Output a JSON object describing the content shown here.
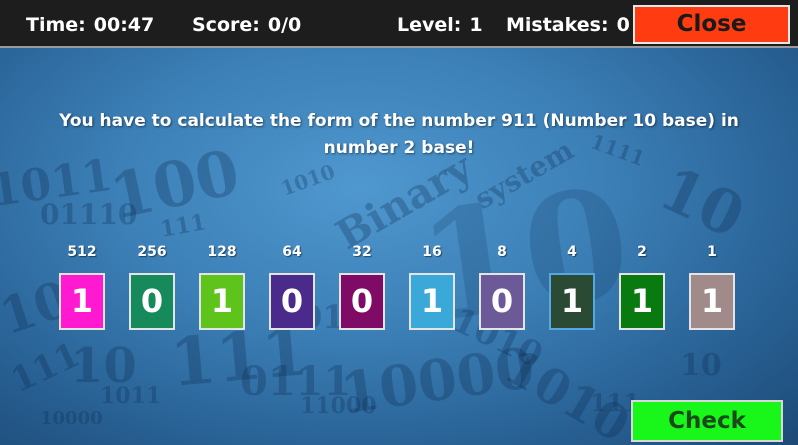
{
  "hud": {
    "time_label": "Time:",
    "time_value": "00:47",
    "score_label": "Score:",
    "score_value": "0/0",
    "level_label": "Level:",
    "level_value": "1",
    "mistakes_label": "Mistakes:",
    "mistakes_value": "0",
    "close_label": "Close"
  },
  "question": {
    "line1": "You have to calculate the form of the number 911 (Number 10 base) in",
    "line2": "number 2 base!"
  },
  "bits": [
    {
      "weight": "512",
      "value": "1",
      "color": "#ff1ad1"
    },
    {
      "weight": "256",
      "value": "0",
      "color": "#178a5c"
    },
    {
      "weight": "128",
      "value": "1",
      "color": "#5ec41c"
    },
    {
      "weight": "64",
      "value": "0",
      "color": "#4a2a8a"
    },
    {
      "weight": "32",
      "value": "0",
      "color": "#800b66"
    },
    {
      "weight": "16",
      "value": "1",
      "color": "#3aa8d8"
    },
    {
      "weight": "8",
      "value": "0",
      "color": "#6c5a98"
    },
    {
      "weight": "4",
      "value": "1",
      "color": "#2a4a34",
      "selected": true
    },
    {
      "weight": "2",
      "value": "1",
      "color": "#087a10"
    },
    {
      "weight": "1",
      "value": "1",
      "color": "#a08a8a"
    }
  ],
  "check_label": "Check",
  "colors": {
    "close_button": "#ff3b12",
    "check_button": "#19f71a",
    "topbar": "#1d1d1d"
  }
}
